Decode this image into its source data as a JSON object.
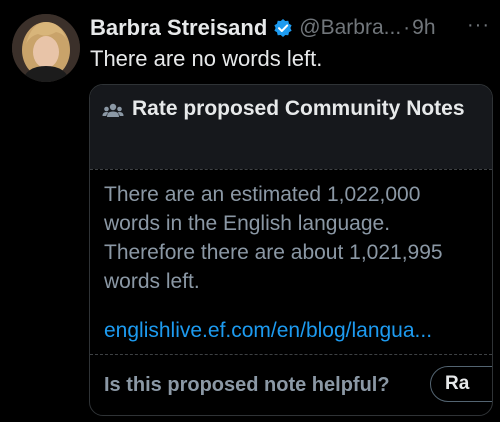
{
  "tweet": {
    "author_name": "Barbra Streisand",
    "handle": "@Barbra...",
    "separator": "·",
    "time": "9h",
    "more_icon": "more-horizontal-icon",
    "verified_icon": "verified-badge-icon",
    "verified_color": "#1d9bf0",
    "text": "There are no words left."
  },
  "community_note": {
    "header_icon": "people-icon",
    "title": "Rate proposed Community Notes",
    "body": "There are an estimated 1,022,000 words in the English language. Therefore there are about 1,021,995 words left.",
    "link": "englishlive.ef.com/en/blog/langua...",
    "question": "Is this proposed note helpful?",
    "rate_button": "Ra",
    "link_color": "#1d9bf0"
  }
}
